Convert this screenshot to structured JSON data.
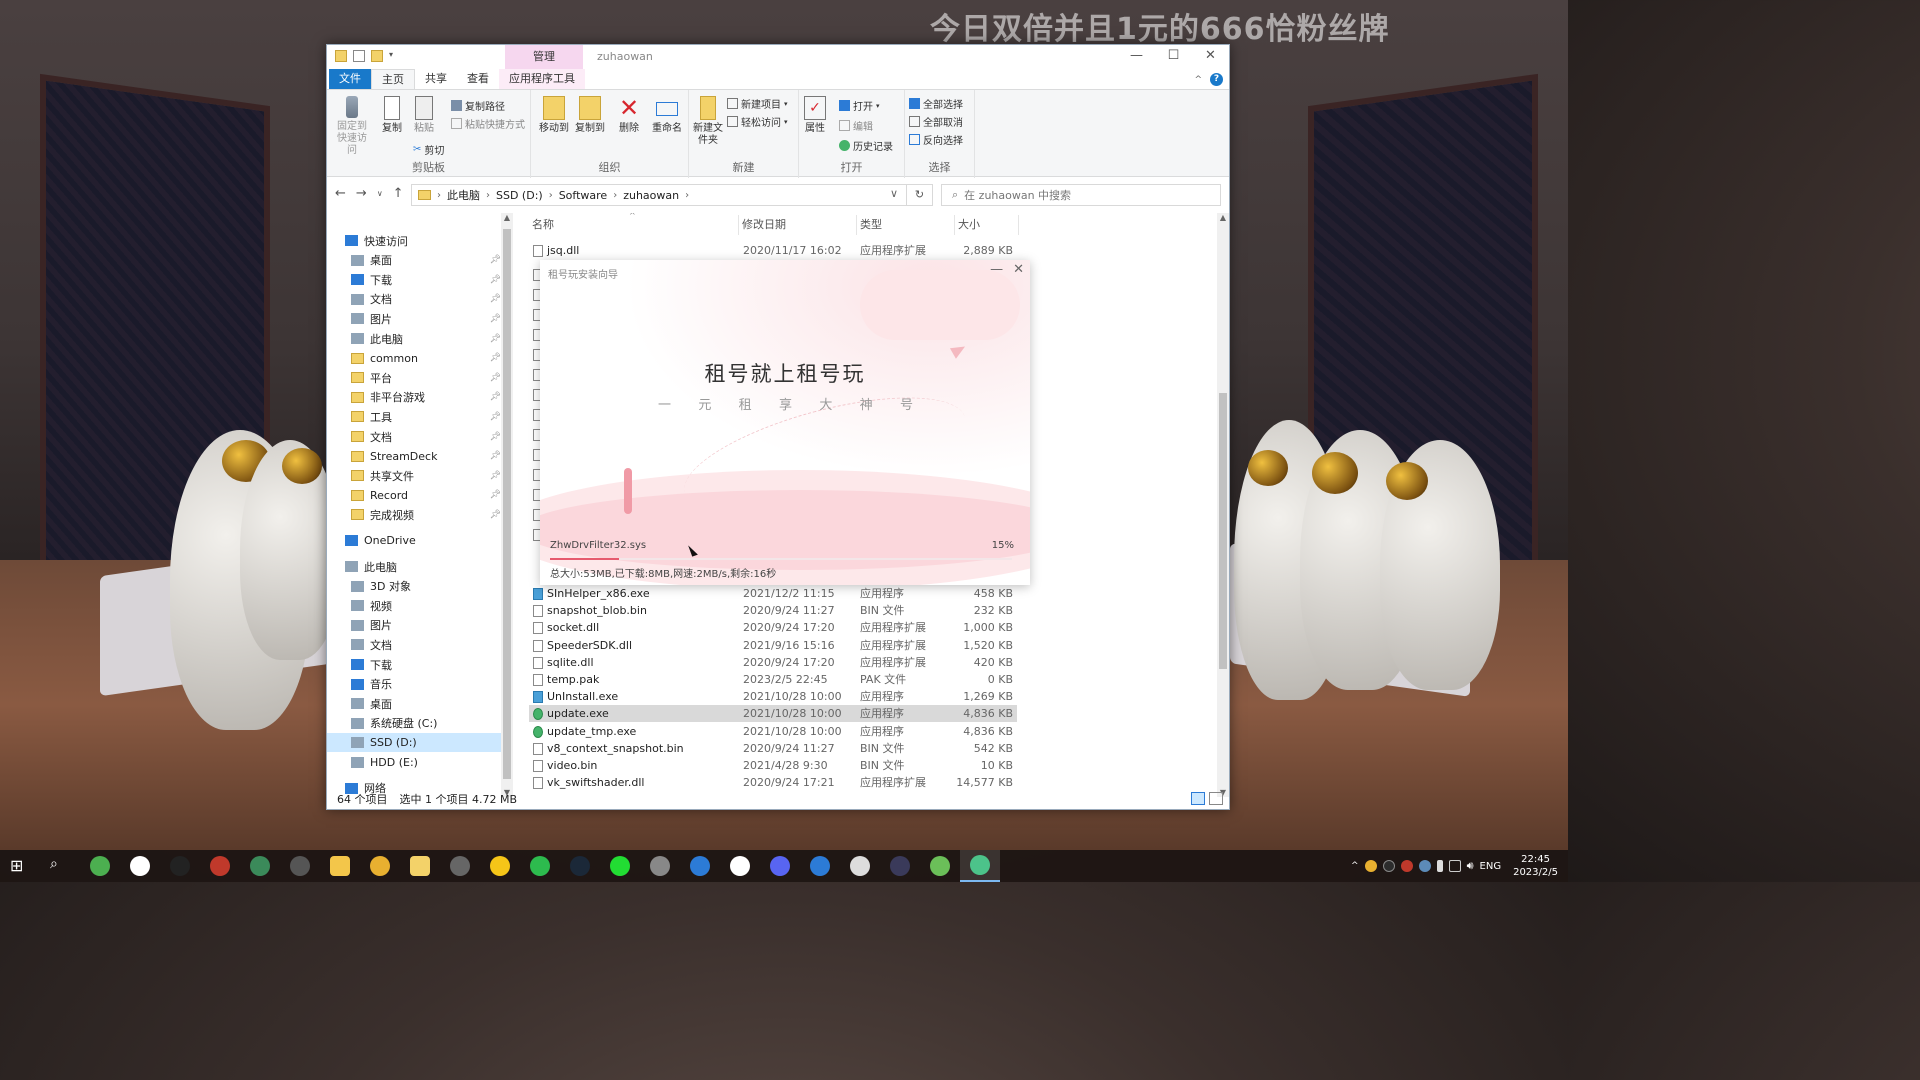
{
  "banner": "今日双倍并且1元的666恰粉丝牌",
  "window": {
    "manage_tab": "管理",
    "title": "zuhaowan",
    "controls": {
      "min": "—",
      "max": "☐",
      "close": "✕"
    }
  },
  "tabs": [
    "文件",
    "主页",
    "共享",
    "查看",
    "应用程序工具"
  ],
  "ribbon": {
    "clipboard": {
      "pin": "固定到快速访问",
      "copy": "复制",
      "paste": "粘贴",
      "copy_path": "复制路径",
      "paste_shortcut": "粘贴快捷方式",
      "cut": "剪切",
      "label": "剪贴板"
    },
    "organize": {
      "move_to": "移动到",
      "copy_to": "复制到",
      "delete": "删除",
      "rename": "重命名",
      "label": "组织"
    },
    "new": {
      "new_folder": "新建文件夹",
      "new_item": "新建项目",
      "easy_access": "轻松访问",
      "label": "新建"
    },
    "open": {
      "properties": "属性",
      "open": "打开",
      "edit": "编辑",
      "history": "历史记录",
      "label": "打开"
    },
    "select": {
      "select_all": "全部选择",
      "select_none": "全部取消",
      "invert": "反向选择",
      "label": "选择"
    }
  },
  "address": {
    "crumbs": [
      "此电脑",
      "SSD (D:)",
      "Software",
      "zuhaowan"
    ],
    "search_placeholder": "在 zuhaowan 中搜索"
  },
  "nav": {
    "quick_access": "快速访问",
    "pinned": [
      "桌面",
      "下载",
      "文档",
      "图片",
      "此电脑",
      "common",
      "平台",
      "非平台游戏",
      "工具",
      "文档",
      "StreamDeck",
      "共享文件",
      "Record",
      "完成视频"
    ],
    "onedrive": "OneDrive",
    "this_pc": "此电脑",
    "pc_items": [
      "3D 对象",
      "视频",
      "图片",
      "文档",
      "下载",
      "音乐",
      "桌面",
      "系统硬盘 (C:)",
      "SSD (D:)",
      "HDD (E:)"
    ],
    "network": "网络"
  },
  "columns": {
    "name": "名称",
    "date": "修改日期",
    "type": "类型",
    "size": "大小"
  },
  "files_top": [
    {
      "name": "jsq.dll",
      "date": "2020/11/17 16:02",
      "type": "应用程序扩展",
      "size": "2,889 KB"
    }
  ],
  "files": [
    {
      "name": "SInHelper_x86.exe",
      "date": "2021/12/2 11:15",
      "type": "应用程序",
      "size": "458 KB",
      "icon": "exe"
    },
    {
      "name": "snapshot_blob.bin",
      "date": "2020/9/24 11:27",
      "type": "BIN 文件",
      "size": "232 KB",
      "icon": "file"
    },
    {
      "name": "socket.dll",
      "date": "2020/9/24 17:20",
      "type": "应用程序扩展",
      "size": "1,000 KB",
      "icon": "file"
    },
    {
      "name": "SpeederSDK.dll",
      "date": "2021/9/16 15:16",
      "type": "应用程序扩展",
      "size": "1,520 KB",
      "icon": "file"
    },
    {
      "name": "sqlite.dll",
      "date": "2020/9/24 17:20",
      "type": "应用程序扩展",
      "size": "420 KB",
      "icon": "file"
    },
    {
      "name": "temp.pak",
      "date": "2023/2/5 22:45",
      "type": "PAK 文件",
      "size": "0 KB",
      "icon": "file"
    },
    {
      "name": "UnInstall.exe",
      "date": "2021/10/28 10:00",
      "type": "应用程序",
      "size": "1,269 KB",
      "icon": "exe"
    },
    {
      "name": "update.exe",
      "date": "2021/10/28 10:00",
      "type": "应用程序",
      "size": "4,836 KB",
      "icon": "upd"
    },
    {
      "name": "update_tmp.exe",
      "date": "2021/10/28 10:00",
      "type": "应用程序",
      "size": "4,836 KB",
      "icon": "upd"
    },
    {
      "name": "v8_context_snapshot.bin",
      "date": "2020/9/24 11:27",
      "type": "BIN 文件",
      "size": "542 KB",
      "icon": "file"
    },
    {
      "name": "video.bin",
      "date": "2021/4/28 9:30",
      "type": "BIN 文件",
      "size": "10 KB",
      "icon": "file"
    },
    {
      "name": "vk_swiftshader.dll",
      "date": "2020/9/24 17:21",
      "type": "应用程序扩展",
      "size": "14,577 KB",
      "icon": "file"
    }
  ],
  "status": {
    "count": "64 个项目",
    "selected": "选中 1 个项目  4.72 MB"
  },
  "installer": {
    "title": "租号玩安装向导",
    "slogan": "租号就上租号玩",
    "sub_chars": [
      "一",
      "元",
      "租",
      "享",
      "大",
      "神",
      "号"
    ],
    "current_file": "ZhwDrvFilter32.sys",
    "percent_text": "15%",
    "progress": 0.15,
    "info": "总大小:53MB,已下载:8MB,网速:2MB/s,剩余:16秒"
  },
  "taskbar": {
    "apps": [
      "start-icon",
      "search-icon",
      "xbox-icon",
      "app-icon",
      "app-icon",
      "app-icon",
      "terminal-icon",
      "app-icon",
      "explorer-icon",
      "chrome-icon",
      "files-icon",
      "app-icon",
      "app-icon",
      "wechat-icon",
      "steam-icon",
      "app-icon",
      "app-icon",
      "app-icon",
      "app-icon",
      "discord-icon",
      "app-icon",
      "app-icon",
      "app-icon",
      "app-icon",
      "installer-icon"
    ],
    "lang": "ENG",
    "time": "22:45",
    "date": "2023/2/5"
  },
  "colors": {
    "accent": "#1979ca",
    "manage": "#f6d7ef",
    "progress": "#e65a6e"
  }
}
